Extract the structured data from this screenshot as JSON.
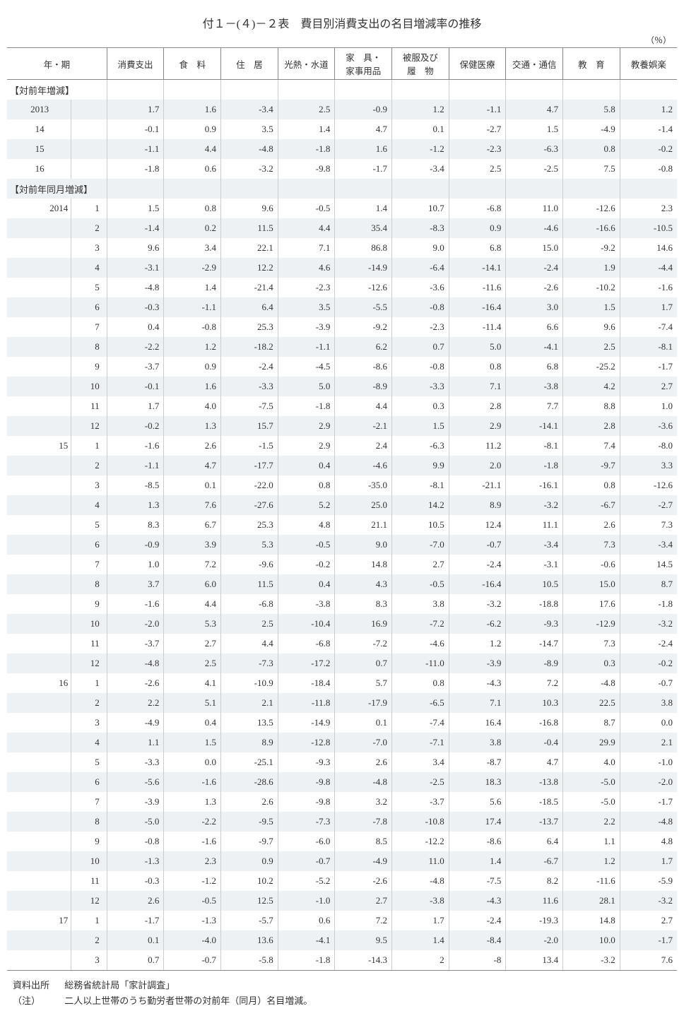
{
  "title": "付１－(４)－２表　費目別消費支出の名目増減率の推移",
  "unit": "（％）",
  "headers": {
    "period": "年・期",
    "cols": [
      "消費支出",
      "食　料",
      "住　居",
      "光熱・水道",
      "家　具・\n家事用品",
      "被服及び\n履　物",
      "保健医療",
      "交通・通信",
      "教　育",
      "教養娯楽"
    ]
  },
  "section1": "【対前年増減】",
  "section2": "【対前年同月増減】",
  "annual": [
    {
      "year": "2013",
      "v": [
        "1.7",
        "1.6",
        "-3.4",
        "2.5",
        "-0.9",
        "1.2",
        "-1.1",
        "4.7",
        "5.8",
        "1.2"
      ]
    },
    {
      "year": "14",
      "v": [
        "-0.1",
        "0.9",
        "3.5",
        "1.4",
        "4.7",
        "0.1",
        "-2.7",
        "1.5",
        "-4.9",
        "-1.4"
      ]
    },
    {
      "year": "15",
      "v": [
        "-1.1",
        "4.4",
        "-4.8",
        "-1.8",
        "1.6",
        "-1.2",
        "-2.3",
        "-6.3",
        "0.8",
        "-0.2"
      ]
    },
    {
      "year": "16",
      "v": [
        "-1.8",
        "0.6",
        "-3.2",
        "-9.8",
        "-1.7",
        "-3.4",
        "2.5",
        "-2.5",
        "7.5",
        "-0.8"
      ]
    }
  ],
  "monthly": [
    {
      "year": "2014",
      "month": "1",
      "v": [
        "1.5",
        "0.8",
        "9.6",
        "-0.5",
        "1.4",
        "10.7",
        "-6.8",
        "11.0",
        "-12.6",
        "2.3"
      ]
    },
    {
      "year": "",
      "month": "2",
      "v": [
        "-1.4",
        "0.2",
        "11.5",
        "4.4",
        "35.4",
        "-8.3",
        "0.9",
        "-4.6",
        "-16.6",
        "-10.5"
      ]
    },
    {
      "year": "",
      "month": "3",
      "v": [
        "9.6",
        "3.4",
        "22.1",
        "7.1",
        "86.8",
        "9.0",
        "6.8",
        "15.0",
        "-9.2",
        "14.6"
      ]
    },
    {
      "year": "",
      "month": "4",
      "v": [
        "-3.1",
        "-2.9",
        "12.2",
        "4.6",
        "-14.9",
        "-6.4",
        "-14.1",
        "-2.4",
        "1.9",
        "-4.4"
      ]
    },
    {
      "year": "",
      "month": "5",
      "v": [
        "-4.8",
        "1.4",
        "-21.4",
        "-2.3",
        "-12.6",
        "-3.6",
        "-11.6",
        "-2.6",
        "-10.2",
        "-1.6"
      ]
    },
    {
      "year": "",
      "month": "6",
      "v": [
        "-0.3",
        "-1.1",
        "6.4",
        "3.5",
        "-5.5",
        "-0.8",
        "-16.4",
        "3.0",
        "1.5",
        "1.7"
      ]
    },
    {
      "year": "",
      "month": "7",
      "v": [
        "0.4",
        "-0.8",
        "25.3",
        "-3.9",
        "-9.2",
        "-2.3",
        "-11.4",
        "6.6",
        "9.6",
        "-7.4"
      ]
    },
    {
      "year": "",
      "month": "8",
      "v": [
        "-2.2",
        "1.2",
        "-18.2",
        "-1.1",
        "6.2",
        "0.7",
        "5.0",
        "-4.1",
        "2.5",
        "-8.1"
      ]
    },
    {
      "year": "",
      "month": "9",
      "v": [
        "-3.7",
        "0.9",
        "-2.4",
        "-4.5",
        "-8.6",
        "-0.8",
        "0.8",
        "6.8",
        "-25.2",
        "-1.7"
      ]
    },
    {
      "year": "",
      "month": "10",
      "v": [
        "-0.1",
        "1.6",
        "-3.3",
        "5.0",
        "-8.9",
        "-3.3",
        "7.1",
        "-3.8",
        "4.2",
        "2.7"
      ]
    },
    {
      "year": "",
      "month": "11",
      "v": [
        "1.7",
        "4.0",
        "-7.5",
        "-1.8",
        "4.4",
        "0.3",
        "2.8",
        "7.7",
        "8.8",
        "1.0"
      ]
    },
    {
      "year": "",
      "month": "12",
      "v": [
        "-0.2",
        "1.3",
        "15.7",
        "2.9",
        "-2.1",
        "1.5",
        "2.9",
        "-14.1",
        "2.8",
        "-3.6"
      ]
    },
    {
      "year": "15",
      "month": "1",
      "v": [
        "-1.6",
        "2.6",
        "-1.5",
        "2.9",
        "2.4",
        "-6.3",
        "11.2",
        "-8.1",
        "7.4",
        "-8.0"
      ]
    },
    {
      "year": "",
      "month": "2",
      "v": [
        "-1.1",
        "4.7",
        "-17.7",
        "0.4",
        "-4.6",
        "9.9",
        "2.0",
        "-1.8",
        "-9.7",
        "3.3"
      ]
    },
    {
      "year": "",
      "month": "3",
      "v": [
        "-8.5",
        "0.1",
        "-22.0",
        "0.8",
        "-35.0",
        "-8.1",
        "-21.1",
        "-16.1",
        "0.8",
        "-12.6"
      ]
    },
    {
      "year": "",
      "month": "4",
      "v": [
        "1.3",
        "7.6",
        "-27.6",
        "5.2",
        "25.0",
        "14.2",
        "8.9",
        "-3.2",
        "-6.7",
        "-2.7"
      ]
    },
    {
      "year": "",
      "month": "5",
      "v": [
        "8.3",
        "6.7",
        "25.3",
        "4.8",
        "21.1",
        "10.5",
        "12.4",
        "11.1",
        "2.6",
        "7.3"
      ]
    },
    {
      "year": "",
      "month": "6",
      "v": [
        "-0.9",
        "3.9",
        "5.3",
        "-0.5",
        "9.0",
        "-7.0",
        "-0.7",
        "-3.4",
        "7.3",
        "-3.4"
      ]
    },
    {
      "year": "",
      "month": "7",
      "v": [
        "1.0",
        "7.2",
        "-9.6",
        "-0.2",
        "14.8",
        "2.7",
        "-2.4",
        "-3.1",
        "-0.6",
        "14.5"
      ]
    },
    {
      "year": "",
      "month": "8",
      "v": [
        "3.7",
        "6.0",
        "11.5",
        "0.4",
        "4.3",
        "-0.5",
        "-16.4",
        "10.5",
        "15.0",
        "8.7"
      ]
    },
    {
      "year": "",
      "month": "9",
      "v": [
        "-1.6",
        "4.4",
        "-6.8",
        "-3.8",
        "8.3",
        "3.8",
        "-3.2",
        "-18.8",
        "17.6",
        "-1.8"
      ]
    },
    {
      "year": "",
      "month": "10",
      "v": [
        "-2.0",
        "5.3",
        "2.5",
        "-10.4",
        "16.9",
        "-7.2",
        "-6.2",
        "-9.3",
        "-12.9",
        "-3.2"
      ]
    },
    {
      "year": "",
      "month": "11",
      "v": [
        "-3.7",
        "2.7",
        "4.4",
        "-6.8",
        "-7.2",
        "-4.6",
        "1.2",
        "-14.7",
        "7.3",
        "-2.4"
      ]
    },
    {
      "year": "",
      "month": "12",
      "v": [
        "-4.8",
        "2.5",
        "-7.3",
        "-17.2",
        "0.7",
        "-11.0",
        "-3.9",
        "-8.9",
        "0.3",
        "-0.2"
      ]
    },
    {
      "year": "16",
      "month": "1",
      "v": [
        "-2.6",
        "4.1",
        "-10.9",
        "-18.4",
        "5.7",
        "0.8",
        "-4.3",
        "7.2",
        "-4.8",
        "-0.7"
      ]
    },
    {
      "year": "",
      "month": "2",
      "v": [
        "2.2",
        "5.1",
        "2.1",
        "-11.8",
        "-17.9",
        "-6.5",
        "7.1",
        "10.3",
        "22.5",
        "3.8"
      ]
    },
    {
      "year": "",
      "month": "3",
      "v": [
        "-4.9",
        "0.4",
        "13.5",
        "-14.9",
        "0.1",
        "-7.4",
        "16.4",
        "-16.8",
        "8.7",
        "0.0"
      ]
    },
    {
      "year": "",
      "month": "4",
      "v": [
        "1.1",
        "1.5",
        "8.9",
        "-12.8",
        "-7.0",
        "-7.1",
        "3.8",
        "-0.4",
        "29.9",
        "2.1"
      ]
    },
    {
      "year": "",
      "month": "5",
      "v": [
        "-3.3",
        "0.0",
        "-25.1",
        "-9.3",
        "2.6",
        "3.4",
        "-8.7",
        "4.7",
        "4.0",
        "-1.0"
      ]
    },
    {
      "year": "",
      "month": "6",
      "v": [
        "-5.6",
        "-1.6",
        "-28.6",
        "-9.8",
        "-4.8",
        "-2.5",
        "18.3",
        "-13.8",
        "-5.0",
        "-2.0"
      ]
    },
    {
      "year": "",
      "month": "7",
      "v": [
        "-3.9",
        "1.3",
        "2.6",
        "-9.8",
        "3.2",
        "-3.7",
        "5.6",
        "-18.5",
        "-5.0",
        "-1.7"
      ]
    },
    {
      "year": "",
      "month": "8",
      "v": [
        "-5.0",
        "-2.2",
        "-9.5",
        "-7.3",
        "-7.8",
        "-10.8",
        "17.4",
        "-13.7",
        "2.2",
        "-4.8"
      ]
    },
    {
      "year": "",
      "month": "9",
      "v": [
        "-0.8",
        "-1.6",
        "-9.7",
        "-6.0",
        "8.5",
        "-12.2",
        "-8.6",
        "6.4",
        "1.1",
        "4.8"
      ]
    },
    {
      "year": "",
      "month": "10",
      "v": [
        "-1.3",
        "2.3",
        "0.9",
        "-0.7",
        "-4.9",
        "11.0",
        "1.4",
        "-6.7",
        "1.2",
        "1.7"
      ]
    },
    {
      "year": "",
      "month": "11",
      "v": [
        "-0.3",
        "-1.2",
        "10.2",
        "-5.2",
        "-2.6",
        "-4.8",
        "-7.5",
        "8.2",
        "-11.6",
        "-5.9"
      ]
    },
    {
      "year": "",
      "month": "12",
      "v": [
        "2.6",
        "-0.5",
        "12.5",
        "-1.0",
        "2.7",
        "-3.8",
        "-4.3",
        "11.6",
        "28.1",
        "-3.2"
      ]
    },
    {
      "year": "17",
      "month": "1",
      "v": [
        "-1.7",
        "-1.3",
        "-5.7",
        "0.6",
        "7.2",
        "1.7",
        "-2.4",
        "-19.3",
        "14.8",
        "2.7"
      ]
    },
    {
      "year": "",
      "month": "2",
      "v": [
        "0.1",
        "-4.0",
        "13.6",
        "-4.1",
        "9.5",
        "1.4",
        "-8.4",
        "-2.0",
        "10.0",
        "-1.7"
      ]
    },
    {
      "year": "",
      "month": "3",
      "v": [
        "0.7",
        "-0.7",
        "-5.8",
        "-1.8",
        "-14.3",
        "2",
        "-8",
        "13.4",
        "-3.2",
        "7.6"
      ]
    }
  ],
  "footnote": {
    "sourceLabel": "資料出所",
    "sourceText": "総務省統計局「家計調査」",
    "noteLabel": "（注）",
    "noteText": "二人以上世帯のうち勤労者世帯の対前年（同月）名目増減。"
  }
}
